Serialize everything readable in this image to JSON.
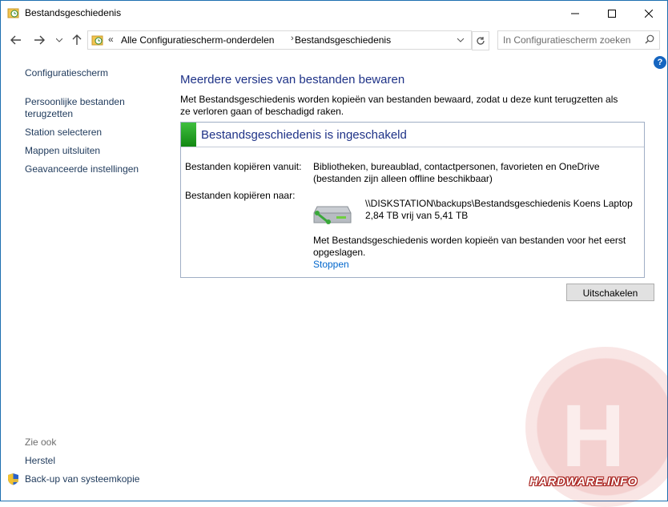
{
  "window": {
    "title": "Bestandsgeschiedenis"
  },
  "navbar": {
    "breadcrumb_root": "Alle Configuratiescherm-onderdelen",
    "breadcrumb_current": "Bestandsgeschiedenis",
    "search_placeholder": "In Configuratiescherm zoeken"
  },
  "sidebar": {
    "home": "Configuratiescherm",
    "restore_line1": "Persoonlijke bestanden",
    "restore_line2": "terugzetten",
    "select_drive": "Station selecteren",
    "exclude": "Mappen uitsluiten",
    "advanced": "Geavanceerde instellingen",
    "see_also": "Zie ook",
    "recovery": "Herstel",
    "system_image": "Back-up van systeemkopie"
  },
  "main": {
    "heading": "Meerdere versies van bestanden bewaren",
    "intro": "Met Bestandsgeschiedenis worden kopieën van bestanden bewaard, zodat u deze kunt terugzetten als ze verloren gaan of beschadigd raken.",
    "status_title": "Bestandsgeschiedenis is ingeschakeld",
    "copy_from_label": "Bestanden kopiëren vanuit:",
    "copy_from_line1": "Bibliotheken, bureaublad, contactpersonen, favorieten en OneDrive",
    "copy_from_line2": "(bestanden zijn alleen offline beschikbaar)",
    "copy_to_label": "Bestanden kopiëren naar:",
    "drive_path": "\\\\DISKSTATION\\backups\\Bestandsgeschiedenis Koens Laptop",
    "drive_space": "2,84 TB vrij van 5,41 TB",
    "progress_line1": "Met Bestandsgeschiedenis worden kopieën van bestanden voor het eerst",
    "progress_line2": "opgeslagen.",
    "stop_link": "Stoppen",
    "disable_button": "Uitschakelen"
  },
  "watermark": {
    "text": "HARDWARE.INFO",
    "letter": "H"
  },
  "colors": {
    "heading": "#1e3287",
    "link": "#0066cc",
    "status_green": "#128812"
  }
}
